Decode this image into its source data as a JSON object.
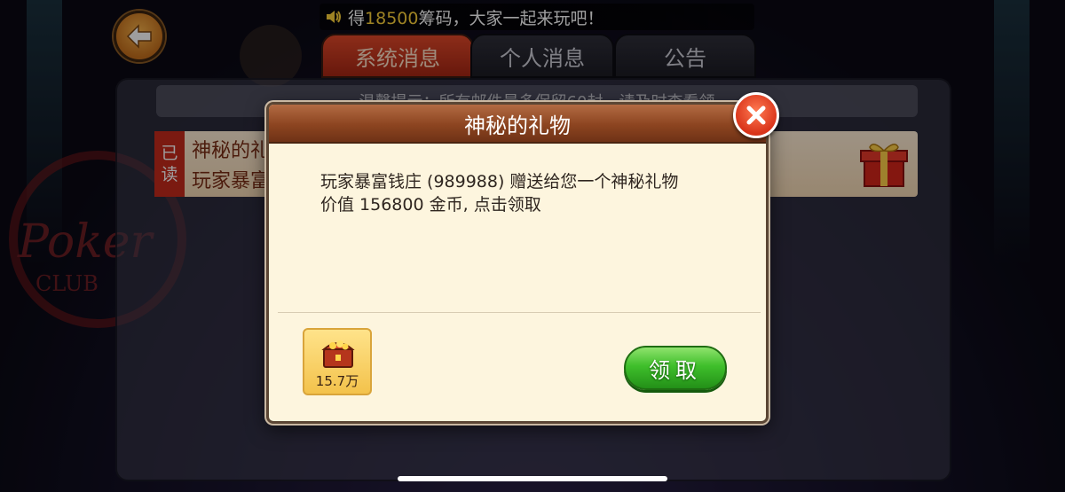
{
  "ticker": {
    "prefix": "得",
    "amount": "18500",
    "suffix": "筹码，大家一起来玩吧！"
  },
  "tabs": [
    {
      "label": "系统消息",
      "active": true
    },
    {
      "label": "个人消息",
      "active": false
    },
    {
      "label": "公告",
      "active": false
    }
  ],
  "background_panel": {
    "hint": "温馨提示：所有邮件最多保留60封，请及时查看领",
    "mail_item": {
      "read_tag": [
        "已",
        "读"
      ],
      "title": "神秘的礼物",
      "subtitle": "玩家暴富钱庄"
    },
    "logo_text": [
      "Poker",
      "CLUB"
    ]
  },
  "modal": {
    "title": "神秘的礼物",
    "message_line1": "玩家暴富钱庄 (989988) 赠送给您一个神秘礼物",
    "message_line2": "价值 156800 金币, 点击领取",
    "reward_label": "15.7万",
    "claim_label": "领取"
  },
  "colors": {
    "accent_orange": "#e2492a",
    "claim_green": "#3fbf2b",
    "ticker_highlight": "#ffd43b"
  }
}
